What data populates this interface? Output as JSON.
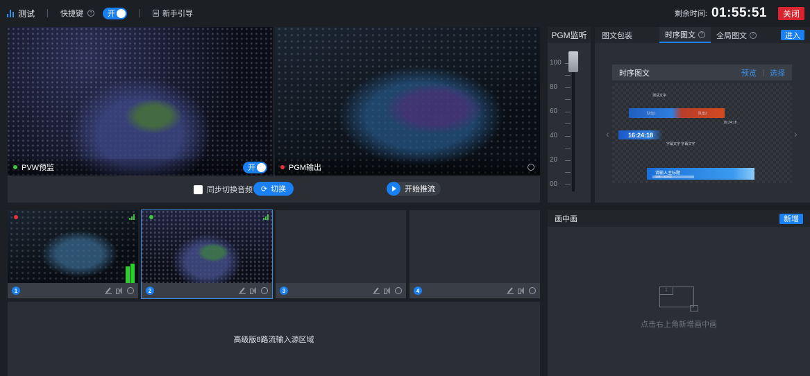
{
  "topbar": {
    "title": "测试",
    "hotkey_label": "快捷键",
    "hotkey_toggle": "开",
    "guide_label": "新手引导",
    "remaining_label": "剩余时间:",
    "remaining_time": "01:55:51",
    "close_label": "关闭"
  },
  "preview": {
    "pvw_label": "PVW预监",
    "pvw_toggle": "开",
    "pgm_label": "PGM输出"
  },
  "controls": {
    "sync_audio_label": "同步切换音频",
    "switch_label": "切换",
    "start_push_label": "开始推流"
  },
  "sources": [
    {
      "number": "1"
    },
    {
      "number": "2"
    },
    {
      "number": "3"
    },
    {
      "number": "4"
    }
  ],
  "advanced_area_text": "高级版8路流输入源区域",
  "pgm_monitor": {
    "title": "PGM监听",
    "scale": [
      "100",
      "80",
      "60",
      "40",
      "20",
      "00"
    ]
  },
  "graphics": {
    "tabs": [
      "图文包装",
      "时序图文",
      "全局图文"
    ],
    "active_tab": "时序图文",
    "enter_label": "进入",
    "card_title": "时序图文",
    "preview_label": "预览",
    "select_label": "选择",
    "clock_text": "16:24:18",
    "tiny_clock": "16:24:18",
    "subtitle_text": "请输入主标题",
    "subtitle_sub": "请输入副标题",
    "score_left": "队伍1",
    "score_right": "队伍2",
    "top_text": "测试文字",
    "mid_text": "字幕文字 字幕文字"
  },
  "pip": {
    "title": "画中画",
    "add_label": "新增",
    "empty_text": "点击右上角新增画中画",
    "icon_number": "1"
  },
  "colors": {
    "accent": "#1a7ff0",
    "danger": "#d9232d",
    "panel": "#2b2f35",
    "bg": "#1c1f24"
  }
}
